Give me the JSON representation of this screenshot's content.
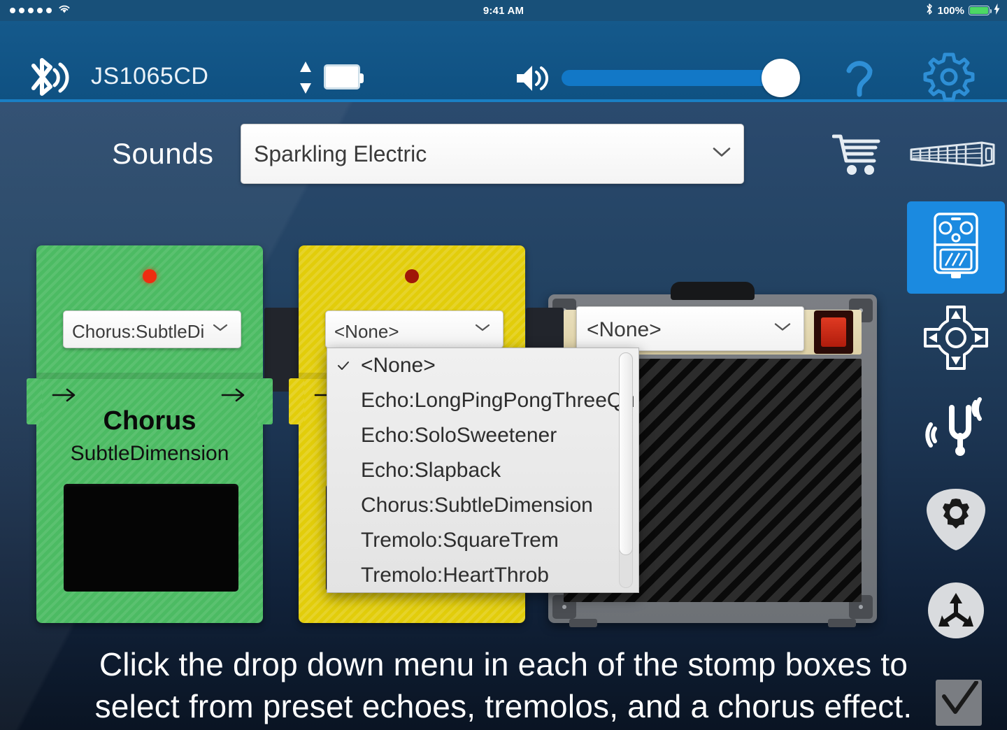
{
  "status_bar": {
    "signal_dots": 5,
    "wifi_icon": "wifi-icon",
    "time": "9:41 AM",
    "bluetooth_icon": "bluetooth-icon",
    "battery_percent": "100%",
    "battery_color": "#4cd964",
    "charging_icon": "lightning-bolt-icon"
  },
  "toolbar": {
    "bluetooth_icon": "bluetooth-signal-icon",
    "device_name": "JS1065CD",
    "transfer_icon": "up-down-arrows-icon",
    "battery_icon": "battery-icon",
    "volume_icon": "speaker-volume-icon",
    "volume_value": 100,
    "help_icon": "question-mark-icon",
    "settings_icon": "gear-icon",
    "accent_color": "#1a7fc4",
    "background_color": "#0f5182"
  },
  "sounds": {
    "label": "Sounds",
    "selected": "Sparkling Electric",
    "caret_icon": "chevron-down-icon",
    "cart_icon": "shopping-cart-icon",
    "fretboard_icon": "fretboard-icon"
  },
  "rail": {
    "items": [
      {
        "name": "stomp-pedal",
        "icon": "stomp-pedal-icon",
        "active": true
      },
      {
        "name": "d-pad",
        "icon": "dpad-icon",
        "active": false
      },
      {
        "name": "tuner",
        "icon": "tuning-fork-icon",
        "active": false
      },
      {
        "name": "pick-settings",
        "icon": "guitar-pick-gear-icon",
        "active": false
      },
      {
        "name": "routing",
        "icon": "three-way-arrows-icon",
        "active": false
      }
    ],
    "active_color": "#1b8ae0"
  },
  "pedals": [
    {
      "color_name": "green",
      "body_color": "#4cbb63",
      "led": "on",
      "led_color": "#ee2d10",
      "select_value": "Chorus:SubtleDi",
      "caret_icon": "chevron-down-icon",
      "arrow_left_icon": "arrow-right-icon",
      "arrow_right_icon": "arrow-right-icon",
      "title": "Chorus",
      "subtitle": "SubtleDimension",
      "footswitch": "footswitch-panel"
    },
    {
      "color_name": "yellow",
      "body_color": "#e2cd0a",
      "led": "off",
      "led_color": "#a01808",
      "select_value": "<None>",
      "caret_icon": "chevron-down-icon",
      "arrow_left_icon": "arrow-right-icon",
      "arrow_right_icon": "arrow-right-icon",
      "title": "",
      "subtitle": "",
      "footswitch": "footswitch-panel"
    }
  ],
  "amp": {
    "handle_icon": "amp-handle",
    "select_value": "<None>",
    "caret_icon": "chevron-down-icon",
    "jewel_light": "red-jewel-light",
    "jewel_color": "#e03a22",
    "grille": "speaker-grille"
  },
  "dropdown_menu": {
    "open_for": "yellow-pedal",
    "selected_index": 0,
    "check_icon": "check-mark-icon",
    "items": [
      "<None>",
      "Echo:LongPingPongThreeQu",
      "Echo:SoloSweetener",
      "Echo:Slapback",
      "Chorus:SubtleDimension",
      "Tremolo:SquareTrem",
      "Tremolo:HeartThrob"
    ],
    "scrollbar": "vertical-scrollbar"
  },
  "caption": {
    "line1": "Click the drop down menu in each of the stomp boxes to",
    "line2": "select from preset echoes, tremolos, and a chorus effect.",
    "check_icon": "checkbox-checked-icon"
  }
}
